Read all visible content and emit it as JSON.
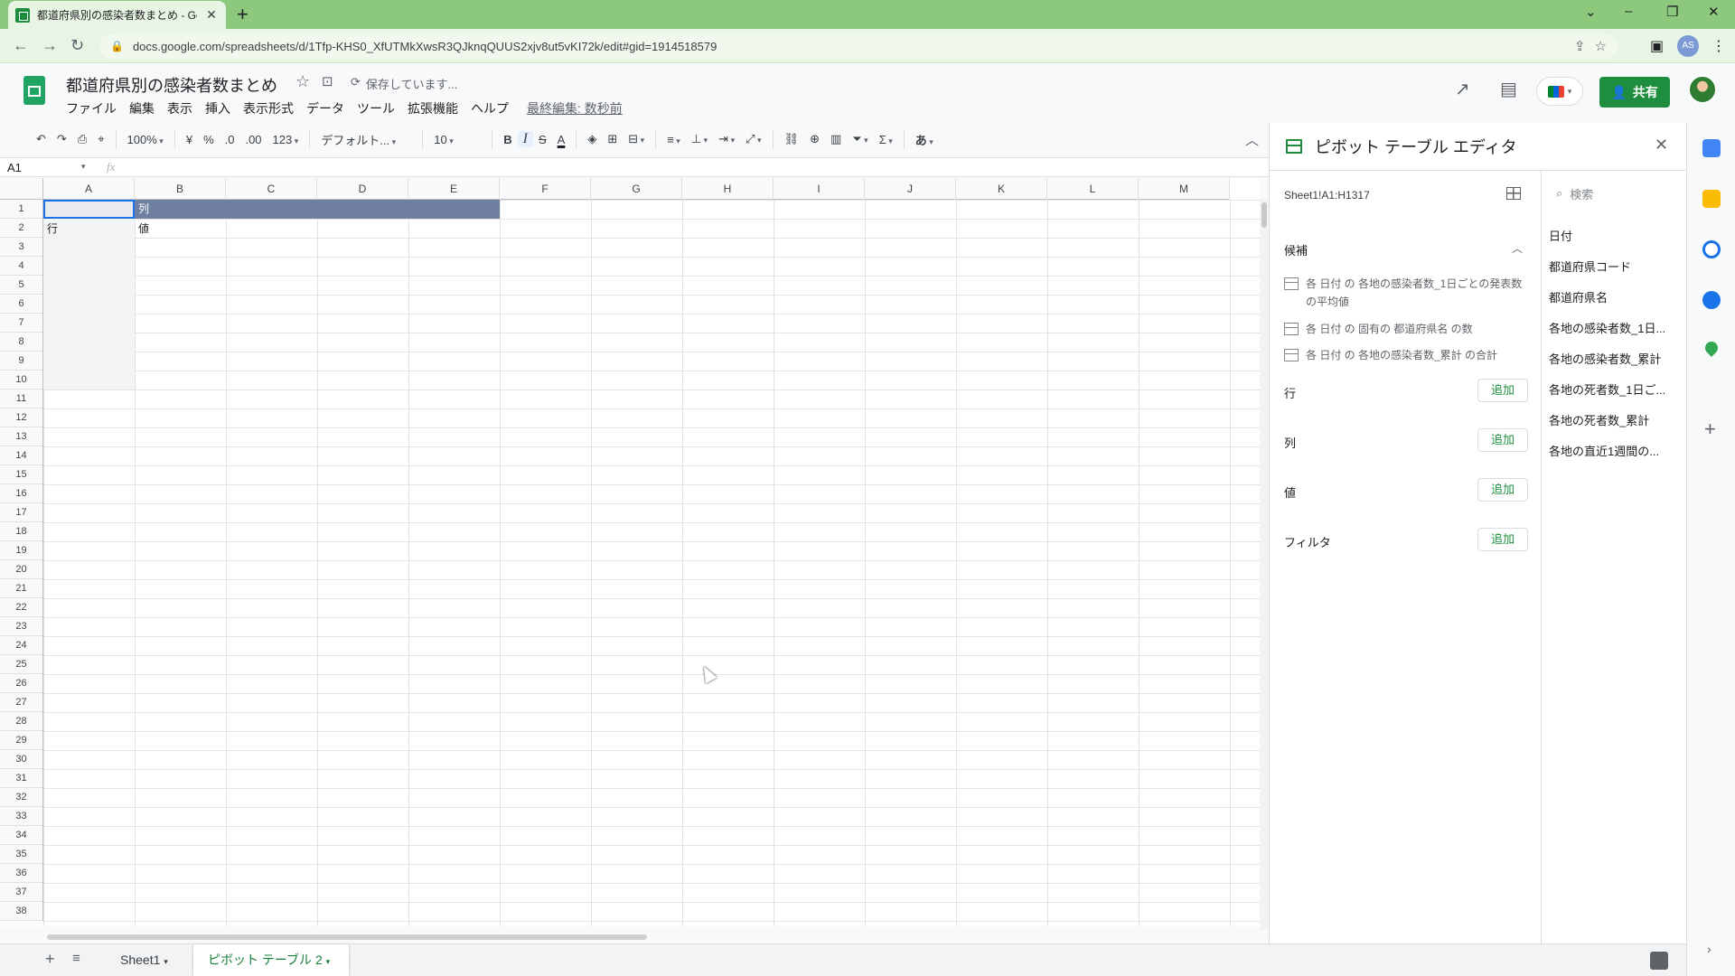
{
  "browser": {
    "tab_title": "都道府県別の感染者数まとめ - Go",
    "url": "docs.google.com/spreadsheets/d/1Tfp-KHS0_XfUTMkXwsR3QJknqQUUS2xjv8ut5vKI72k/edit#gid=1914518579",
    "profile_initials": "AS"
  },
  "doc": {
    "title": "都道府県別の感染者数まとめ",
    "status": "保存しています...",
    "menus": [
      "ファイル",
      "編集",
      "表示",
      "挿入",
      "表示形式",
      "データ",
      "ツール",
      "拡張機能",
      "ヘルプ"
    ],
    "last_edit": "最終編集: 数秒前",
    "share_label": "共有"
  },
  "toolbar": {
    "zoom": "100%",
    "currency": "¥",
    "percent": "%",
    "dec_less": ".0",
    "dec_more": ".00",
    "format_more": "123",
    "font": "デフォルト...",
    "font_size": "10",
    "bold": "B",
    "italic": "I",
    "strike": "S",
    "text_color": "A",
    "input_tools": "あ"
  },
  "formula": {
    "cell_ref": "A1",
    "fx": "fx"
  },
  "grid": {
    "columns": [
      "A",
      "B",
      "C",
      "D",
      "E",
      "F",
      "G",
      "H",
      "I",
      "J",
      "K",
      "L",
      "M"
    ],
    "rows": [
      "1",
      "2",
      "3",
      "4",
      "5",
      "6",
      "7",
      "8",
      "9",
      "10",
      "11",
      "12",
      "13",
      "14",
      "15",
      "16",
      "17",
      "18",
      "19",
      "20",
      "21",
      "22",
      "23",
      "24",
      "25",
      "26",
      "27",
      "28",
      "29",
      "30",
      "31",
      "32",
      "33",
      "34",
      "35",
      "36",
      "37",
      "38"
    ],
    "b1": "列",
    "a2": "行",
    "b2": "値"
  },
  "sheets": {
    "sheet1": "Sheet1",
    "pivot": "ピボット テーブル 2"
  },
  "pivot_editor": {
    "title": "ピボット テーブル エディタ",
    "range": "Sheet1!A1:H1317",
    "suggestions_label": "候補",
    "suggestions": [
      "各 日付 の 各地の感染者数_1日ごとの発表数 の平均値",
      "各 日付 の 固有の 都道府県名 の数",
      "各 日付 の 各地の感染者数_累計 の合計"
    ],
    "sections": [
      {
        "label": "行",
        "add": "追加"
      },
      {
        "label": "列",
        "add": "追加"
      },
      {
        "label": "値",
        "add": "追加"
      },
      {
        "label": "フィルタ",
        "add": "追加"
      }
    ],
    "search_placeholder": "検索",
    "fields": [
      "日付",
      "都道府県コード",
      "都道府県名",
      "各地の感染者数_1日...",
      "各地の感染者数_累計",
      "各地の死者数_1日ご...",
      "各地の死者数_累計",
      "各地の直近1週間の..."
    ]
  },
  "colors": {
    "sheets_green": "#1e8e3e",
    "selection_blue": "#1a73e8",
    "pivot_header_band": "#6f7fa1"
  }
}
